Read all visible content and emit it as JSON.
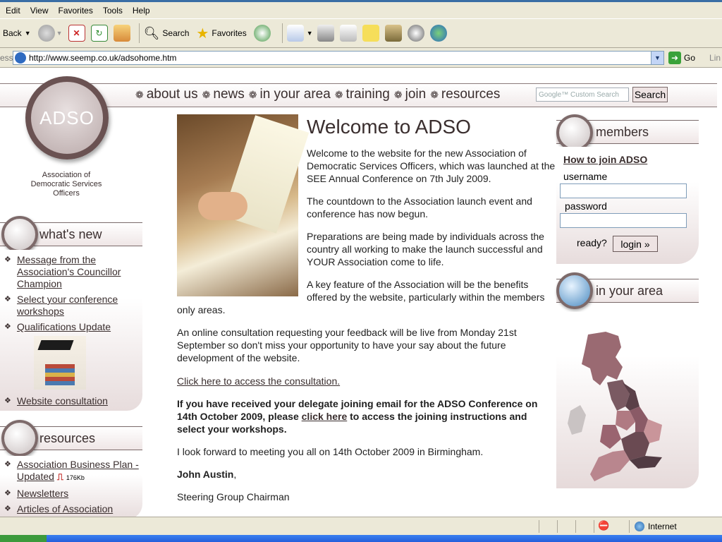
{
  "browser": {
    "menu": [
      "Edit",
      "View",
      "Favorites",
      "Tools",
      "Help"
    ],
    "toolbar": {
      "back_label": "Back",
      "search_label": "Search",
      "favorites_label": "Favorites"
    },
    "address_label": "ess",
    "url": "http://www.seemp.co.uk/adsohome.htm",
    "go_label": "Go",
    "links_label": "Lin",
    "status_zone": "Internet"
  },
  "site": {
    "logo_text": "ADSO",
    "logo_subtitle": "Association of Democratic Services Officers",
    "nav": [
      "about us",
      "news",
      "in your area",
      "training",
      "join",
      "resources"
    ],
    "search_placeholder": "Google™ Custom Search",
    "search_button": "Search"
  },
  "whats_new": {
    "title": "what's new",
    "items": [
      "Message from the Association's Councillor Champion",
      "Select your conference workshops",
      "Qualifications Update",
      "Website consultation"
    ]
  },
  "resources": {
    "title": "resources",
    "items": [
      "Association Business Plan - Updated",
      "Newsletters",
      "Articles of Association"
    ],
    "file_size": "176Kb"
  },
  "main": {
    "title": "Welcome to ADSO",
    "p1": "Welcome to the website for the new Association of Democratic Services Officers, which was launched at the SEE Annual Conference on 7th July 2009.",
    "p2": "The countdown to the Association launch event and conference has now begun.",
    "p3": "Preparations are being made by individuals across the country all working to make the launch successful and YOUR Association come to life.",
    "p4_line1": "A key feature of the Association will be the benefits",
    "p4_line2": "offered by the website, particularly within the members",
    "p4_line3": "only areas.",
    "p5": "An online consultation requesting your feedback will be live from Monday 21st September so don't miss your opportunity to have your say about the future development of the website.",
    "consultation_link": "Click here to access the consultation.",
    "p6_before": "If you have received your delegate joining email for the ADSO Conference on 14th October 2009, please ",
    "p6_link": "click here",
    "p6_after": " to access the joining instructions and select your workshops.",
    "p7": "I look forward to meeting you all on 14th October 2009 in Birmingham.",
    "signature_name": "John Austin",
    "signature_comma": ",",
    "signature_role": "Steering Group Chairman"
  },
  "members": {
    "title": "members",
    "join_link": "How to join ADSO",
    "username_label": "username",
    "password_label": "password",
    "ready_label": "ready?",
    "login_button": "login »"
  },
  "area": {
    "title": "in your area"
  },
  "colors": {
    "brand": "#6a5252",
    "accent_text": "#3a2e2e",
    "panel_gradient_end": "#e7dcdc"
  }
}
